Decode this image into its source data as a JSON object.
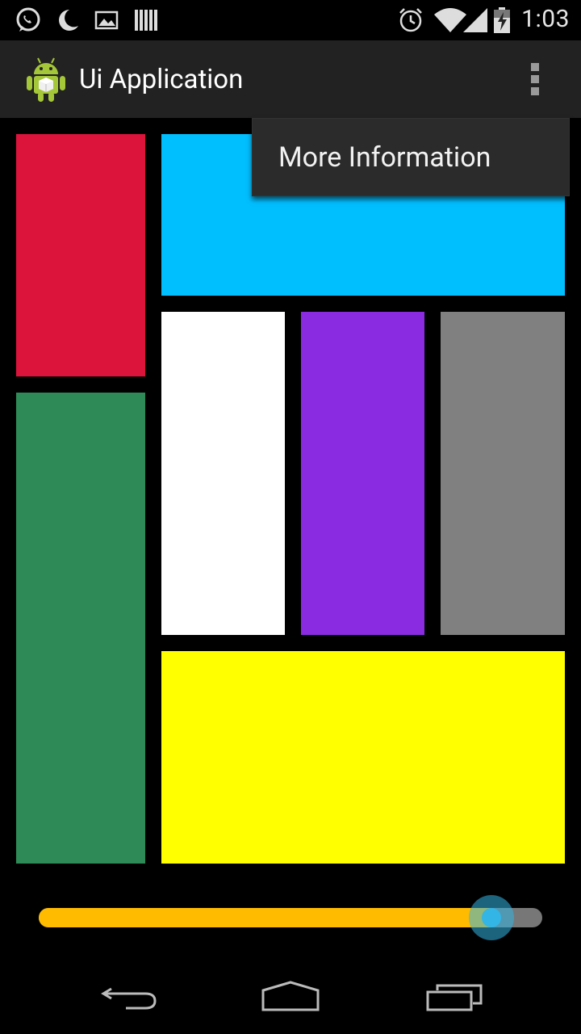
{
  "status_bar": {
    "time": "1:03",
    "left_icons": [
      "whatsapp-icon",
      "moon-icon",
      "image-icon",
      "barcode-icon"
    ],
    "right_icons": [
      "alarm-icon",
      "wifi-icon",
      "signal-icon",
      "battery-charging-icon"
    ]
  },
  "action_bar": {
    "title": "Ui Application",
    "icon": "android-icon",
    "overflow_icon": "overflow-menu-icon"
  },
  "menu": {
    "items": [
      {
        "label": "More Information"
      }
    ]
  },
  "tiles": {
    "colors": {
      "red": "#dc143c",
      "blue": "#00bfff",
      "green": "#2e8b57",
      "white": "#ffffff",
      "purple": "#8a2be2",
      "gray": "#808080",
      "yellow": "#ffff00"
    }
  },
  "seekbar": {
    "progress": 0.9,
    "fill_color": "#ffbb00",
    "thumb_color": "#33b5e5"
  },
  "nav_bar": {
    "buttons": [
      "back-icon",
      "home-icon",
      "recents-icon"
    ]
  }
}
